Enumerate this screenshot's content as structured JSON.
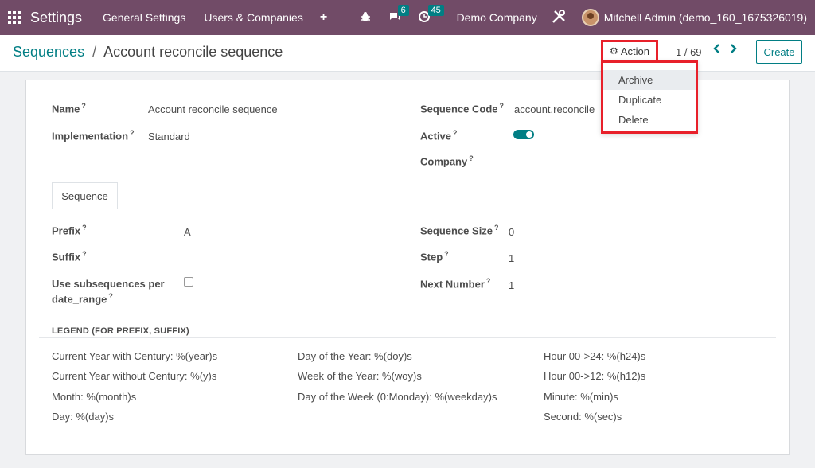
{
  "navbar": {
    "app_title": "Settings",
    "menus": [
      "General Settings",
      "Users & Companies"
    ],
    "plus": "+",
    "messages_count": "6",
    "activities_count": "45",
    "company": "Demo Company",
    "user": "Mitchell Admin (demo_160_1675326019)"
  },
  "breadcrumb": {
    "parent": "Sequences",
    "separator": "/",
    "current": "Account reconcile sequence"
  },
  "toolbar": {
    "action_label": "Action",
    "pager": "1 / 69",
    "create_label": "Create"
  },
  "action_menu": {
    "items": [
      "Archive",
      "Duplicate",
      "Delete"
    ]
  },
  "form": {
    "name_label": "Name",
    "name_value": "Account reconcile sequence",
    "implementation_label": "Implementation",
    "implementation_value": "Standard",
    "sequence_code_label": "Sequence Code",
    "sequence_code_value": "account.reconcile",
    "active_label": "Active",
    "active_value": true,
    "company_label": "Company",
    "help_mark": "?"
  },
  "tab": {
    "label": "Sequence"
  },
  "sequence": {
    "prefix_label": "Prefix",
    "prefix_value": "A",
    "suffix_label": "Suffix",
    "subseq_label_1": "Use subsequences per",
    "subseq_label_2": "date_range",
    "subseq_checked": false,
    "size_label": "Sequence Size",
    "size_value": "0",
    "step_label": "Step",
    "step_value": "1",
    "next_label": "Next Number",
    "next_value": "1"
  },
  "legend": {
    "title": "LEGEND (FOR PREFIX, SUFFIX)",
    "col1": [
      "Current Year with Century: %(year)s",
      "Current Year without Century: %(y)s",
      "Month: %(month)s",
      "Day: %(day)s"
    ],
    "col2": [
      "Day of the Year: %(doy)s",
      "Week of the Year: %(woy)s",
      "Day of the Week (0:Monday): %(weekday)s"
    ],
    "col3": [
      "Hour 00->24: %(h24)s",
      "Hour 00->12: %(h12)s",
      "Minute: %(min)s",
      "Second: %(sec)s"
    ]
  },
  "colors": {
    "navbar": "#714b67",
    "accent": "#017e84",
    "highlight": "#e8202a"
  }
}
